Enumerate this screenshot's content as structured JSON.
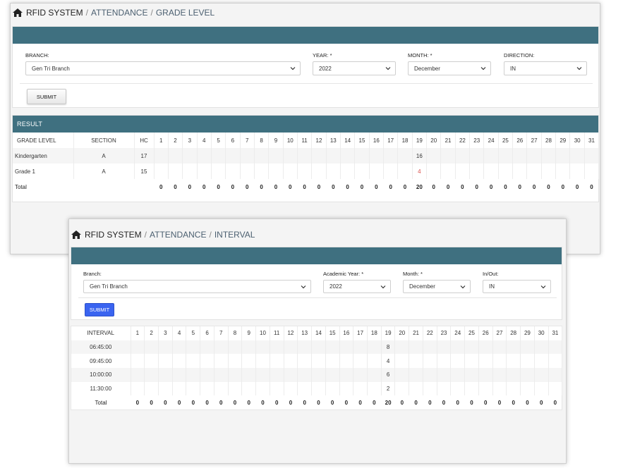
{
  "gradeLevel": {
    "breadcrumb": {
      "root": "RFID SYSTEM",
      "sep": "/",
      "items": [
        "ATTENDANCE",
        "GRADE LEVEL"
      ]
    },
    "filters": {
      "branch": {
        "label": "BRANCH:",
        "value": "Gen Tri Branch"
      },
      "year": {
        "label": "YEAR: *",
        "value": "2022"
      },
      "month": {
        "label": "MONTH: *",
        "value": "December"
      },
      "direction": {
        "label": "DIRECTION:",
        "value": "IN"
      }
    },
    "submit_label": "SUBMIT",
    "result_title": "RESULT",
    "table": {
      "headers": {
        "grade": "GRADE LEVEL",
        "section": "SECTION",
        "hc": "HC"
      },
      "days": [
        "1",
        "2",
        "3",
        "4",
        "5",
        "6",
        "7",
        "8",
        "9",
        "10",
        "11",
        "12",
        "13",
        "14",
        "15",
        "16",
        "17",
        "18",
        "19",
        "20",
        "21",
        "22",
        "23",
        "24",
        "25",
        "26",
        "27",
        "28",
        "29",
        "30",
        "31"
      ],
      "rows": [
        {
          "grade": "Kindergarten",
          "section": "A",
          "hc": "17",
          "cells": [
            "",
            "",
            "",
            "",
            "",
            "",
            "",
            "",
            "",
            "",
            "",
            "",
            "",
            "",
            "",
            "",
            "",
            "",
            "16",
            "",
            "",
            "",
            "",
            "",
            "",
            "",
            "",
            "",
            "",
            "",
            ""
          ]
        },
        {
          "grade": "Grade 1",
          "section": "A",
          "hc": "15",
          "cells": [
            "",
            "",
            "",
            "",
            "",
            "",
            "",
            "",
            "",
            "",
            "",
            "",
            "",
            "",
            "",
            "",
            "",
            "",
            "4",
            "",
            "",
            "",
            "",
            "",
            "",
            "",
            "",
            "",
            "",
            "",
            ""
          ]
        }
      ],
      "total_label": "Total",
      "totals": [
        "0",
        "0",
        "0",
        "0",
        "0",
        "0",
        "0",
        "0",
        "0",
        "0",
        "0",
        "0",
        "0",
        "0",
        "0",
        "0",
        "0",
        "0",
        "20",
        "0",
        "0",
        "0",
        "0",
        "0",
        "0",
        "0",
        "0",
        "0",
        "0",
        "0",
        "0"
      ]
    }
  },
  "interval": {
    "breadcrumb": {
      "root": "RFID SYSTEM",
      "sep": "/",
      "items": [
        "ATTENDANCE",
        "INTERVAL"
      ]
    },
    "filters": {
      "branch": {
        "label": "Branch:",
        "value": "Gen Tri Branch"
      },
      "year": {
        "label": "Academic Year: *",
        "value": "2022"
      },
      "month": {
        "label": "Month: *",
        "value": "December"
      },
      "inout": {
        "label": "In/Out:",
        "value": "IN"
      }
    },
    "submit_label": "SUBMIT",
    "table": {
      "header": "INTERVAL",
      "days": [
        "1",
        "2",
        "3",
        "4",
        "5",
        "6",
        "7",
        "8",
        "9",
        "10",
        "11",
        "12",
        "13",
        "14",
        "15",
        "16",
        "17",
        "18",
        "19",
        "20",
        "21",
        "22",
        "23",
        "24",
        "25",
        "26",
        "27",
        "28",
        "29",
        "30",
        "31"
      ],
      "rows": [
        {
          "interval": "06:45:00",
          "cells": [
            "",
            "",
            "",
            "",
            "",
            "",
            "",
            "",
            "",
            "",
            "",
            "",
            "",
            "",
            "",
            "",
            "",
            "",
            "8",
            "",
            "",
            "",
            "",
            "",
            "",
            "",
            "",
            "",
            "",
            "",
            ""
          ]
        },
        {
          "interval": "09:45:00",
          "cells": [
            "",
            "",
            "",
            "",
            "",
            "",
            "",
            "",
            "",
            "",
            "",
            "",
            "",
            "",
            "",
            "",
            "",
            "",
            "4",
            "",
            "",
            "",
            "",
            "",
            "",
            "",
            "",
            "",
            "",
            "",
            ""
          ]
        },
        {
          "interval": "10:00:00",
          "cells": [
            "",
            "",
            "",
            "",
            "",
            "",
            "",
            "",
            "",
            "",
            "",
            "",
            "",
            "",
            "",
            "",
            "",
            "",
            "6",
            "",
            "",
            "",
            "",
            "",
            "",
            "",
            "",
            "",
            "",
            "",
            ""
          ]
        },
        {
          "interval": "11:30:00",
          "cells": [
            "",
            "",
            "",
            "",
            "",
            "",
            "",
            "",
            "",
            "",
            "",
            "",
            "",
            "",
            "",
            "",
            "",
            "",
            "2",
            "",
            "",
            "",
            "",
            "",
            "",
            "",
            "",
            "",
            "",
            "",
            ""
          ]
        }
      ],
      "total_label": "Total",
      "totals": [
        "0",
        "0",
        "0",
        "0",
        "0",
        "0",
        "0",
        "0",
        "0",
        "0",
        "0",
        "0",
        "0",
        "0",
        "0",
        "0",
        "0",
        "0",
        "20",
        "0",
        "0",
        "0",
        "0",
        "0",
        "0",
        "0",
        "0",
        "0",
        "0",
        "0",
        "0"
      ]
    }
  },
  "colors": {
    "panel_header": "#3f7080",
    "submit_primary": "#3a64f0",
    "alert_value": "#d9534f"
  },
  "icons": {
    "home": "home-icon",
    "dropdown": "chevron-down-icon"
  }
}
